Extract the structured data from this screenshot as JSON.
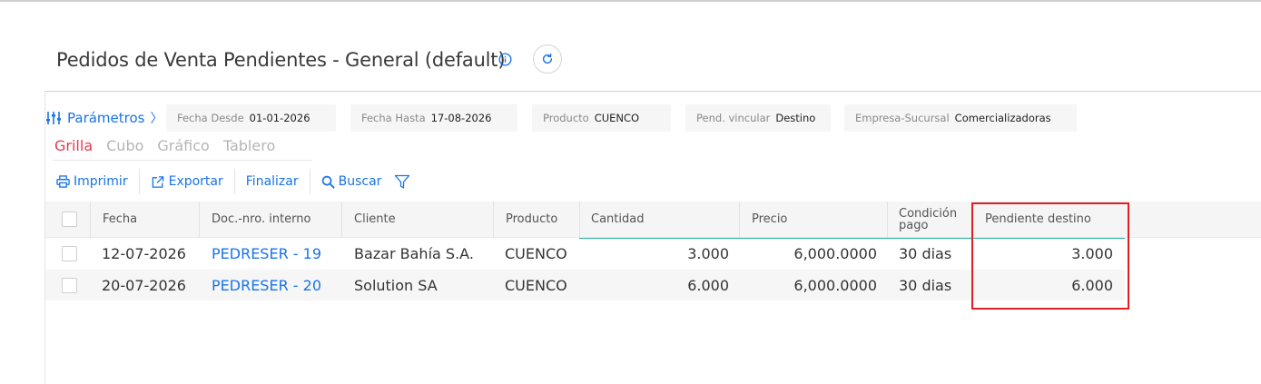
{
  "page": {
    "title": "Pedidos de Venta Pendientes - General (default)"
  },
  "params": {
    "label": "Parámetros",
    "chevron": "〉"
  },
  "filters": [
    {
      "key": "Fecha Desde",
      "value": "01-01-2026"
    },
    {
      "key": "Fecha Hasta",
      "value": "17-08-2026"
    },
    {
      "key": "Producto",
      "value": "CUENCO"
    },
    {
      "key": "Pend. vincular",
      "value": "Destino"
    },
    {
      "key": "Empresa-Sucursal",
      "value": "Comercializadoras"
    }
  ],
  "tabs": [
    {
      "label": "Grilla",
      "active": true
    },
    {
      "label": "Cubo",
      "active": false
    },
    {
      "label": "Gráfico",
      "active": false
    },
    {
      "label": "Tablero",
      "active": false
    }
  ],
  "toolbar": {
    "print": "Imprimir",
    "export": "Exportar",
    "finish": "Finalizar",
    "search": "Buscar"
  },
  "grid": {
    "columns": {
      "fecha": "Fecha",
      "doc": "Doc.-nro. interno",
      "cliente": "Cliente",
      "producto": "Producto",
      "cantidad": "Cantidad",
      "precio": "Precio",
      "condicion_1": "Condición",
      "condicion_2": "pago",
      "pendiente": "Pendiente destino"
    },
    "rows": [
      {
        "fecha": "12-07-2026",
        "doc": "PEDRESER - 19",
        "cliente": "Bazar Bahía S.A.",
        "producto": "CUENCO",
        "cantidad": "3.000",
        "precio": "6,000.0000",
        "condicion": "30 dias",
        "pendiente": "3.000"
      },
      {
        "fecha": "20-07-2026",
        "doc": "PEDRESER - 20",
        "cliente": "Solution SA",
        "producto": "CUENCO",
        "cantidad": "6.000",
        "precio": "6,000.0000",
        "condicion": "30 dias",
        "pendiente": "6.000"
      }
    ]
  },
  "colors": {
    "accent": "#1a73e8",
    "active_tab": "#e8384f",
    "highlight": "#e02020",
    "row_line": "#2bb3a0"
  }
}
